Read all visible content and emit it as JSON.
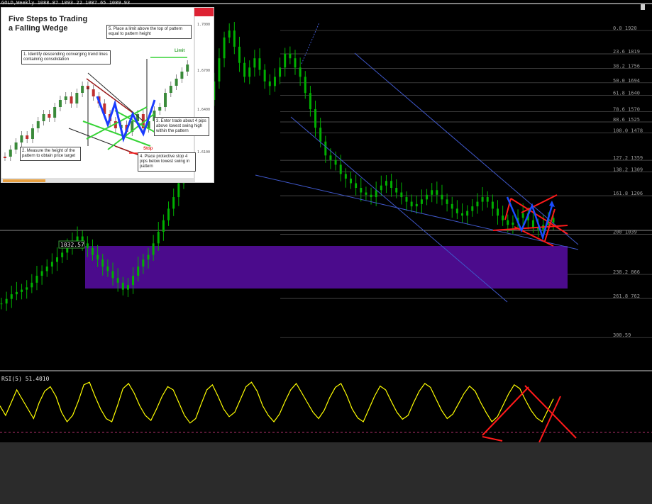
{
  "header": {
    "symbol": "GOLD,Weekly",
    "ohlc": "1088.87 1093.22 1087.65 1089.93"
  },
  "rsi": {
    "label": "RSI(5) 51.4010",
    "series": [
      55,
      40,
      60,
      80,
      65,
      50,
      35,
      60,
      78,
      85,
      70,
      45,
      30,
      40,
      62,
      88,
      92,
      70,
      50,
      35,
      30,
      55,
      82,
      90,
      75,
      55,
      40,
      32,
      50,
      70,
      85,
      80,
      60,
      40,
      28,
      35,
      58,
      80,
      88,
      70,
      50,
      38,
      45,
      65,
      85,
      92,
      78,
      55,
      40,
      30,
      42,
      62,
      80,
      90,
      75,
      60,
      45,
      35,
      48,
      68,
      84,
      90,
      72,
      50,
      36,
      30,
      50,
      70,
      86,
      80,
      62,
      45,
      34,
      40,
      60,
      78,
      90,
      84,
      66,
      48,
      35,
      42,
      58,
      74,
      86,
      78,
      60,
      44,
      30,
      38,
      56,
      74,
      88,
      82,
      64,
      48,
      36,
      30,
      48,
      66
    ],
    "line_color": "#ffff00"
  },
  "inset": {
    "title": "Five Steps to Trading a Falling Wedge",
    "step1": "1. Identify descending converging trend lines containing consolidation",
    "step2": "2. Measure the height of the pattern to obtain price target",
    "step3": "3. Enter trade about 4 pips above lowest swing high within the pattern",
    "step4": "4. Place protective stop 4 pips below lowest swing in pattern",
    "step5": "5. Place a limit above the top of pattern equal to pattern height",
    "limit_label": "Limit",
    "stop_label": "Stop",
    "price_labels": [
      "1.7000",
      "1.6700",
      "1.6400",
      "1.6100"
    ]
  },
  "price_marker": "1032.57",
  "colors": {
    "candles": "#00b000",
    "zone": "#4b0b8c",
    "trendline": "#3f57c9",
    "fib": "#5a5a5a",
    "markup_red": "#ff1a1a",
    "markup_blue": "#1a4dff"
  },
  "fib_levels": [
    {
      "label": "0.0  1920",
      "y": 1920
    },
    {
      "label": "23.6  1819",
      "y": 1819
    },
    {
      "label": "38.2  1756",
      "y": 1756
    },
    {
      "label": "50.0  1694",
      "y": 1694
    },
    {
      "label": "61.8  1640",
      "y": 1640
    },
    {
      "label": "78.6  1570",
      "y": 1570
    },
    {
      "label": "88.6  1525",
      "y": 1525
    },
    {
      "label": "100.0  1478",
      "y": 1478
    },
    {
      "label": "127.2  1359",
      "y": 1359
    },
    {
      "label": "138.2  1309",
      "y": 1309
    },
    {
      "label": "161.8  1206",
      "y": 1206
    },
    {
      "label": "200  1039",
      "y": 1039
    },
    {
      "label": "238.2  866",
      "y": 866
    },
    {
      "label": "261.8  762",
      "y": 762
    },
    {
      "label": "300.59",
      "y": 593
    }
  ],
  "chart_data": {
    "type": "line",
    "title": "",
    "xlabel": "",
    "ylabel": "",
    "ylim": [
      520,
      1960
    ],
    "series": [
      {
        "values": [
          740,
          760,
          780,
          790,
          800,
          810,
          830,
          860,
          880,
          900,
          920,
          940,
          960,
          990,
          1010,
          1030,
          1000,
          980,
          950,
          930,
          900,
          880,
          850,
          830,
          800,
          820,
          860,
          900,
          930,
          950,
          1000,
          1050,
          1100,
          1150,
          1200,
          1260,
          1320,
          1380,
          1440,
          1500,
          1560,
          1620,
          1700,
          1800,
          1890,
          1920,
          1850,
          1780,
          1720,
          1760,
          1800,
          1750,
          1700,
          1680,
          1720,
          1760,
          1820,
          1800,
          1760,
          1720,
          1650,
          1580,
          1500,
          1440,
          1380,
          1360,
          1340,
          1300,
          1280,
          1260,
          1240,
          1220,
          1210,
          1200,
          1230,
          1250,
          1270,
          1240,
          1220,
          1200,
          1180,
          1160,
          1170,
          1190,
          1210,
          1230,
          1210,
          1190,
          1170,
          1150,
          1130,
          1120,
          1140,
          1160,
          1180,
          1200,
          1180,
          1150,
          1120,
          1100,
          1080,
          1090,
          1110,
          1130,
          1100,
          1070,
          1060,
          1080,
          1110,
          1090
        ]
      }
    ]
  }
}
